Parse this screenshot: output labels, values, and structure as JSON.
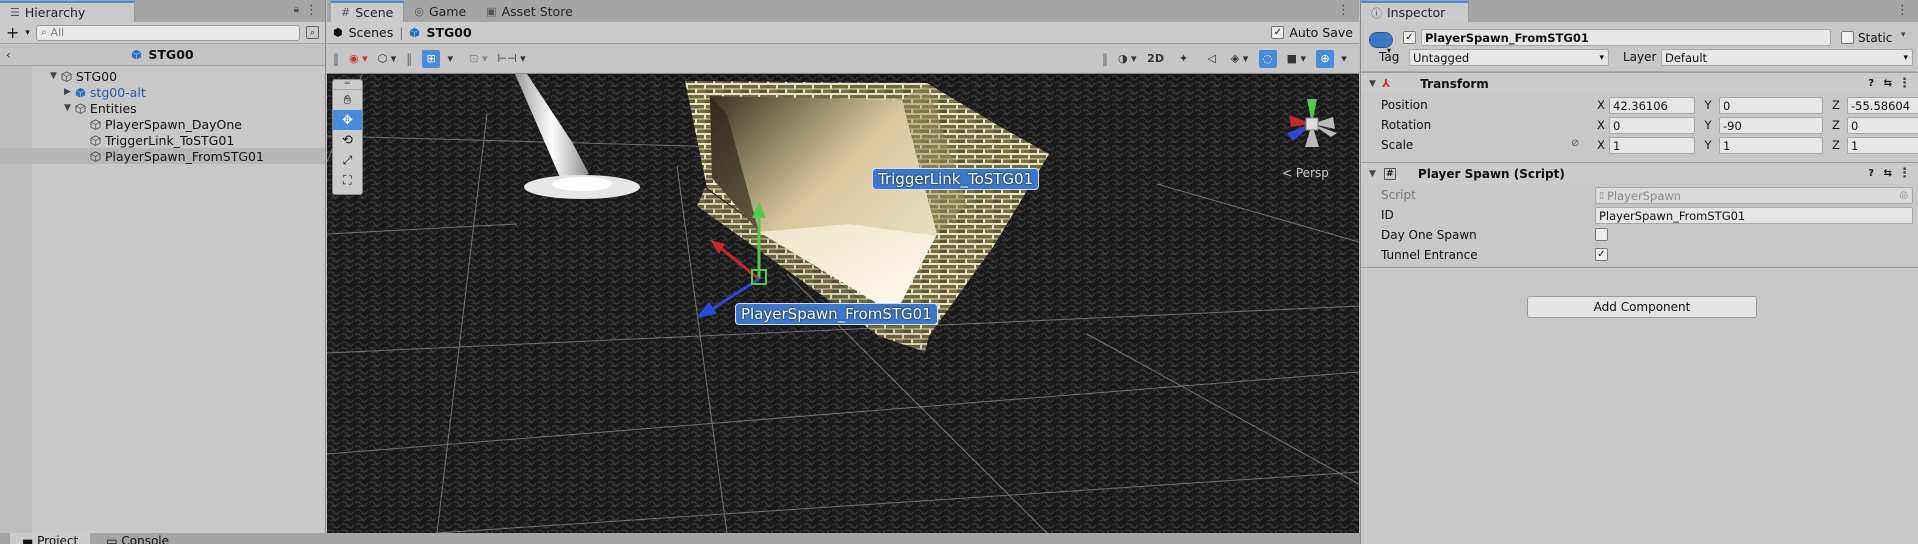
{
  "hierarchy": {
    "tab_label": "Hierarchy",
    "search_placeholder": "All",
    "scene_title": "STG00",
    "items": [
      {
        "label": "STG00",
        "depth": 0
      },
      {
        "label": "stg00-alt",
        "depth": 1
      },
      {
        "label": "Entities",
        "depth": 1
      },
      {
        "label": "PlayerSpawn_DayOne",
        "depth": 2
      },
      {
        "label": "TriggerLink_ToSTG01",
        "depth": 2
      },
      {
        "label": "PlayerSpawn_FromSTG01",
        "depth": 2
      }
    ]
  },
  "bottom_tabs": {
    "project": "Project",
    "console": "Console"
  },
  "scene_view": {
    "tabs": [
      "Scene",
      "Game",
      "Asset Store"
    ],
    "breadcrumb": {
      "root": "Scenes",
      "current": "STG00"
    },
    "auto_save_label": "Auto Save",
    "mode_2d": "2D",
    "persp_label": "< Persp",
    "labels": {
      "trigger": "TriggerLink_ToSTG01",
      "spawn": "PlayerSpawn_FromSTG01"
    }
  },
  "inspector": {
    "tab_label": "Inspector",
    "object_name": "PlayerSpawn_FromSTG01",
    "static_label": "Static",
    "tag_label": "Tag",
    "tag_value": "Untagged",
    "layer_label": "Layer",
    "layer_value": "Default",
    "transform": {
      "title": "Transform",
      "position_label": "Position",
      "rotation_label": "Rotation",
      "scale_label": "Scale",
      "position": {
        "x": "42.36106",
        "y": "0",
        "z": "-55.58604"
      },
      "rotation": {
        "x": "0",
        "y": "-90",
        "z": "0"
      },
      "scale": {
        "x": "1",
        "y": "1",
        "z": "1"
      }
    },
    "script_component": {
      "title": "Player Spawn (Script)",
      "script_label": "Script",
      "script_value": "PlayerSpawn",
      "id_label": "ID",
      "id_value": "PlayerSpawn_FromSTG01",
      "day_one_label": "Day One Spawn",
      "tunnel_label": "Tunnel Entrance"
    },
    "add_component_label": "Add Component"
  },
  "axis_labels": {
    "x": "X",
    "y": "Y",
    "z": "Z"
  },
  "colors": {
    "accent": "#4a8bd9",
    "label_bg": "#3d78c8",
    "prefab": "#1f5fb0"
  }
}
